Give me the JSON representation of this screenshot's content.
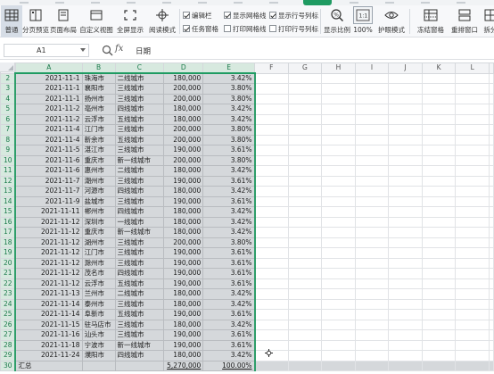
{
  "ribbon": {
    "buttons": [
      {
        "label": "普通",
        "icon": "normal-view-icon"
      },
      {
        "label": "分页预览",
        "icon": "page-break-preview-icon"
      },
      {
        "label": "页面布局",
        "icon": "page-layout-icon"
      },
      {
        "label": "自定义视图",
        "icon": "custom-view-icon"
      },
      {
        "label": "全屏显示",
        "icon": "fullscreen-icon"
      },
      {
        "label": "阅读模式",
        "icon": "reading-mode-icon"
      },
      {
        "label": "显示比例",
        "icon": "zoom-ratio-icon"
      },
      {
        "label": "100%",
        "icon": "zoom-100-icon"
      },
      {
        "label": "护眼模式",
        "icon": "eye-care-icon"
      },
      {
        "label": "冻结窗格",
        "icon": "freeze-panes-icon"
      },
      {
        "label": "重排窗口",
        "icon": "arrange-window-icon"
      },
      {
        "label": "拆分",
        "icon": "split-window-icon"
      }
    ],
    "checks": [
      {
        "label": "编辑栏",
        "checked": true
      },
      {
        "label": "任务窗格",
        "checked": true
      },
      {
        "label": "显示网格线",
        "checked": true
      },
      {
        "label": "打印网格线",
        "checked": false
      },
      {
        "label": "显示行号列标",
        "checked": true
      },
      {
        "label": "打印行号列标",
        "checked": false
      }
    ]
  },
  "formula_bar": {
    "name_box": "A1",
    "fx_label": "fx",
    "content": "日期"
  },
  "sheet": {
    "columns": [
      "A",
      "B",
      "C",
      "D",
      "E",
      "F",
      "G",
      "H",
      "I",
      "J",
      "K",
      "L"
    ],
    "rows": [
      {
        "num": "2",
        "date": "2021-11-1",
        "city": "珠海市",
        "tier": "二线城市",
        "amount": "180,000",
        "pct": "3.42%"
      },
      {
        "num": "3",
        "date": "2021-11-1",
        "city": "襄阳市",
        "tier": "三线城市",
        "amount": "200,000",
        "pct": "3.80%"
      },
      {
        "num": "4",
        "date": "2021-11-1",
        "city": "扬州市",
        "tier": "三线城市",
        "amount": "200,000",
        "pct": "3.80%"
      },
      {
        "num": "5",
        "date": "2021-11-2",
        "city": "亳州市",
        "tier": "四线城市",
        "amount": "180,000",
        "pct": "3.42%"
      },
      {
        "num": "6",
        "date": "2021-11-2",
        "city": "云浮市",
        "tier": "五线城市",
        "amount": "180,000",
        "pct": "3.42%"
      },
      {
        "num": "7",
        "date": "2021-11-4",
        "city": "江门市",
        "tier": "三线城市",
        "amount": "200,000",
        "pct": "3.80%"
      },
      {
        "num": "8",
        "date": "2021-11-4",
        "city": "新余市",
        "tier": "五线城市",
        "amount": "200,000",
        "pct": "3.80%"
      },
      {
        "num": "9",
        "date": "2021-11-5",
        "city": "湛江市",
        "tier": "三线城市",
        "amount": "190,000",
        "pct": "3.61%"
      },
      {
        "num": "10",
        "date": "2021-11-6",
        "city": "重庆市",
        "tier": "新一线城市",
        "amount": "200,000",
        "pct": "3.80%"
      },
      {
        "num": "11",
        "date": "2021-11-6",
        "city": "惠州市",
        "tier": "二线城市",
        "amount": "180,000",
        "pct": "3.42%"
      },
      {
        "num": "12",
        "date": "2021-11-7",
        "city": "潮州市",
        "tier": "三线城市",
        "amount": "190,000",
        "pct": "3.61%"
      },
      {
        "num": "13",
        "date": "2021-11-7",
        "city": "河源市",
        "tier": "四线城市",
        "amount": "180,000",
        "pct": "3.42%"
      },
      {
        "num": "14",
        "date": "2021-11-9",
        "city": "盐城市",
        "tier": "三线城市",
        "amount": "190,000",
        "pct": "3.61%"
      },
      {
        "num": "15",
        "date": "2021-11-11",
        "city": "郴州市",
        "tier": "四线城市",
        "amount": "180,000",
        "pct": "3.42%"
      },
      {
        "num": "16",
        "date": "2021-11-12",
        "city": "深圳市",
        "tier": "一线城市",
        "amount": "180,000",
        "pct": "3.42%"
      },
      {
        "num": "17",
        "date": "2021-11-12",
        "city": "重庆市",
        "tier": "新一线城市",
        "amount": "180,000",
        "pct": "3.42%"
      },
      {
        "num": "18",
        "date": "2021-11-12",
        "city": "湖州市",
        "tier": "三线城市",
        "amount": "200,000",
        "pct": "3.80%"
      },
      {
        "num": "19",
        "date": "2021-11-12",
        "city": "江门市",
        "tier": "三线城市",
        "amount": "190,000",
        "pct": "3.61%"
      },
      {
        "num": "20",
        "date": "2021-11-12",
        "city": "滁州市",
        "tier": "三线城市",
        "amount": "190,000",
        "pct": "3.61%"
      },
      {
        "num": "21",
        "date": "2021-11-12",
        "city": "茂名市",
        "tier": "四线城市",
        "amount": "190,000",
        "pct": "3.61%"
      },
      {
        "num": "22",
        "date": "2021-11-12",
        "city": "云浮市",
        "tier": "五线城市",
        "amount": "190,000",
        "pct": "3.61%"
      },
      {
        "num": "23",
        "date": "2021-11-13",
        "city": "兰州市",
        "tier": "二线城市",
        "amount": "180,000",
        "pct": "3.42%"
      },
      {
        "num": "24",
        "date": "2021-11-14",
        "city": "泰州市",
        "tier": "三线城市",
        "amount": "180,000",
        "pct": "3.42%"
      },
      {
        "num": "25",
        "date": "2021-11-14",
        "city": "阜新市",
        "tier": "五线城市",
        "amount": "190,000",
        "pct": "3.61%"
      },
      {
        "num": "26",
        "date": "2021-11-15",
        "city": "驻马店市",
        "tier": "三线城市",
        "amount": "180,000",
        "pct": "3.42%"
      },
      {
        "num": "27",
        "date": "2021-11-16",
        "city": "汕头市",
        "tier": "三线城市",
        "amount": "190,000",
        "pct": "3.61%"
      },
      {
        "num": "28",
        "date": "2021-11-18",
        "city": "宁波市",
        "tier": "新一线城市",
        "amount": "190,000",
        "pct": "3.61%"
      },
      {
        "num": "29",
        "date": "2021-11-24",
        "city": "濮阳市",
        "tier": "四线城市",
        "amount": "180,000",
        "pct": "3.42%"
      }
    ],
    "total": {
      "num": "30",
      "label": "汇总",
      "amount": "5,270,000",
      "pct": "100.00%"
    }
  },
  "colors": {
    "accent": "#1f9b62",
    "selection_fill": "#d5d8db",
    "header_selected": "#d7e9df"
  }
}
